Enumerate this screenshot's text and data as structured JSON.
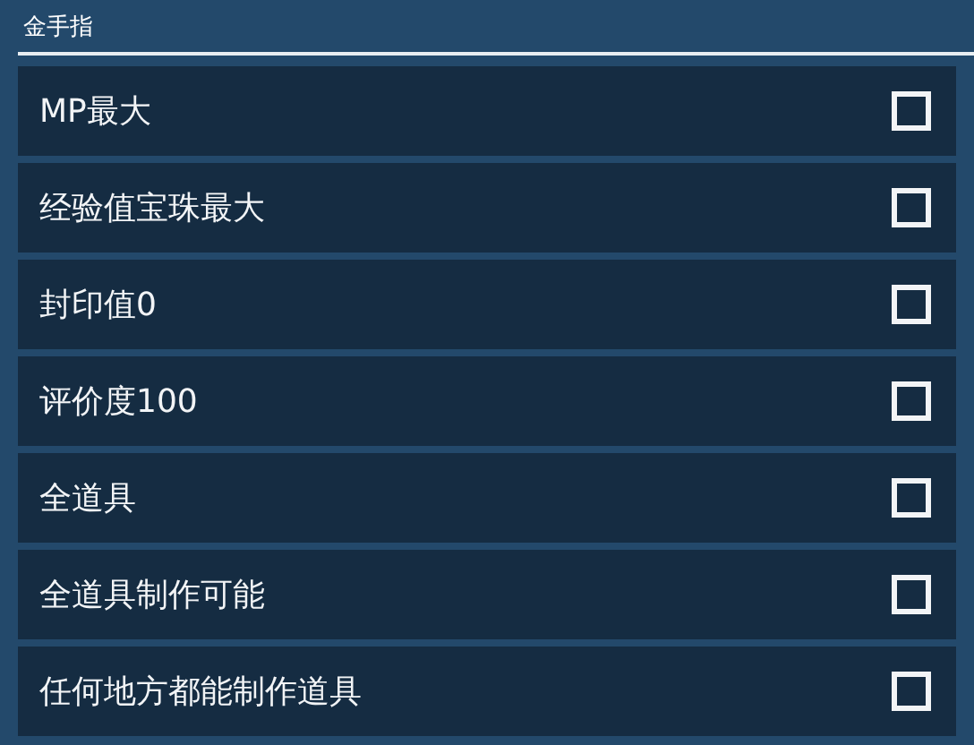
{
  "header": {
    "title": "金手指"
  },
  "cheats": [
    {
      "label": "MP最大",
      "checked": false
    },
    {
      "label": "经验值宝珠最大",
      "checked": false
    },
    {
      "label": "封印值0",
      "checked": false
    },
    {
      "label": "评价度100",
      "checked": false
    },
    {
      "label": "全道具",
      "checked": false
    },
    {
      "label": "全道具制作可能",
      "checked": false
    },
    {
      "label": "任何地方都能制作道具",
      "checked": false
    }
  ]
}
